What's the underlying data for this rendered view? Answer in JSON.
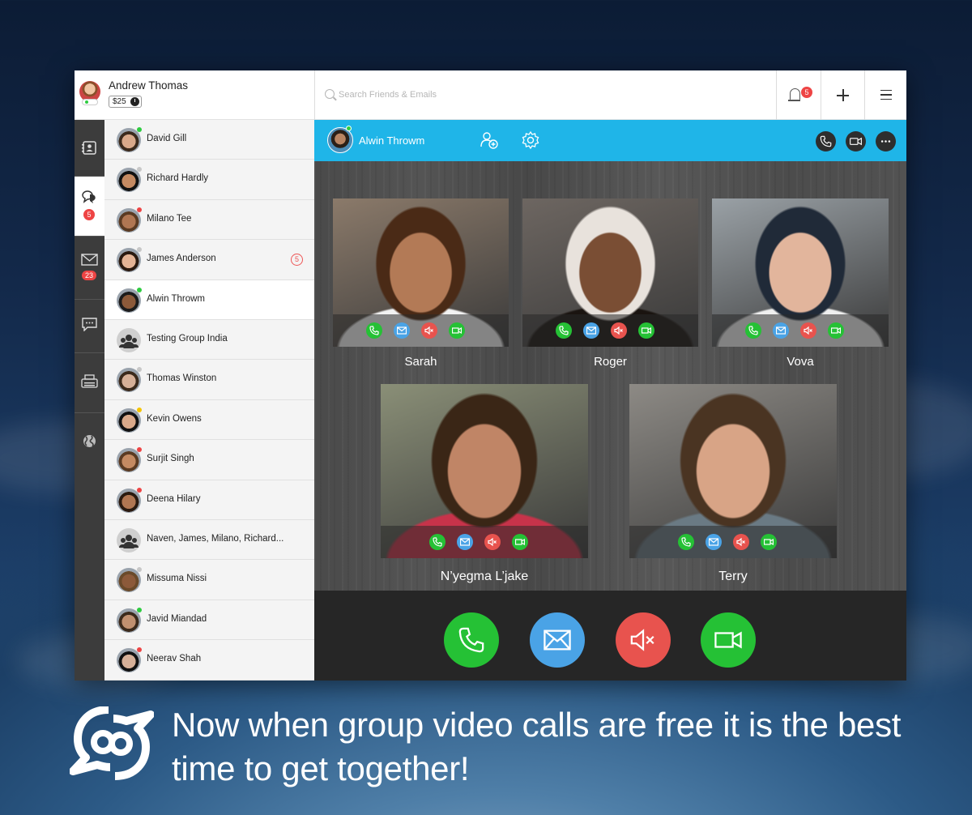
{
  "user": {
    "name": "Andrew Thomas",
    "balance": "$25"
  },
  "search": {
    "placeholder": "Search Friends & Emails"
  },
  "header": {
    "notification_count": "5"
  },
  "rail": {
    "chat_badge": "5",
    "mail_badge": "23"
  },
  "contacts": [
    {
      "name": "David Gill",
      "status": "online"
    },
    {
      "name": "Richard Hardly",
      "status": "offline"
    },
    {
      "name": "Milano Tee",
      "status": "busy"
    },
    {
      "name": "James Anderson",
      "status": "offline",
      "badge": "5"
    },
    {
      "name": "Alwin Throwm",
      "status": "online"
    },
    {
      "name": "Testing Group India",
      "status": "group"
    },
    {
      "name": "Thomas Winston",
      "status": "offline"
    },
    {
      "name": "Kevin Owens",
      "status": "away"
    },
    {
      "name": "Surjit Singh",
      "status": "busy"
    },
    {
      "name": "Deena Hilary",
      "status": "busy"
    },
    {
      "name": "Naven, James, Milano, Richard...",
      "status": "group"
    },
    {
      "name": "Missuma Nissi",
      "status": "offline"
    },
    {
      "name": "Javid Miandad",
      "status": "online"
    },
    {
      "name": "Neerav Shah",
      "status": "busy"
    }
  ],
  "call": {
    "contact_name": "Alwin Throwm",
    "participants": [
      {
        "name": "Sarah"
      },
      {
        "name": "Roger"
      },
      {
        "name": "Vova"
      },
      {
        "name": "N’yegma L’jake"
      },
      {
        "name": "Terry"
      }
    ]
  },
  "colors": {
    "accent_bar": "#1fb5e8",
    "call_green": "#25c135",
    "mail_blue": "#4aa3e6",
    "mute_red": "#e8534e",
    "badge_red": "#e44"
  },
  "promo": {
    "tagline": "Now when group video calls are free it is the best time to get together!"
  }
}
